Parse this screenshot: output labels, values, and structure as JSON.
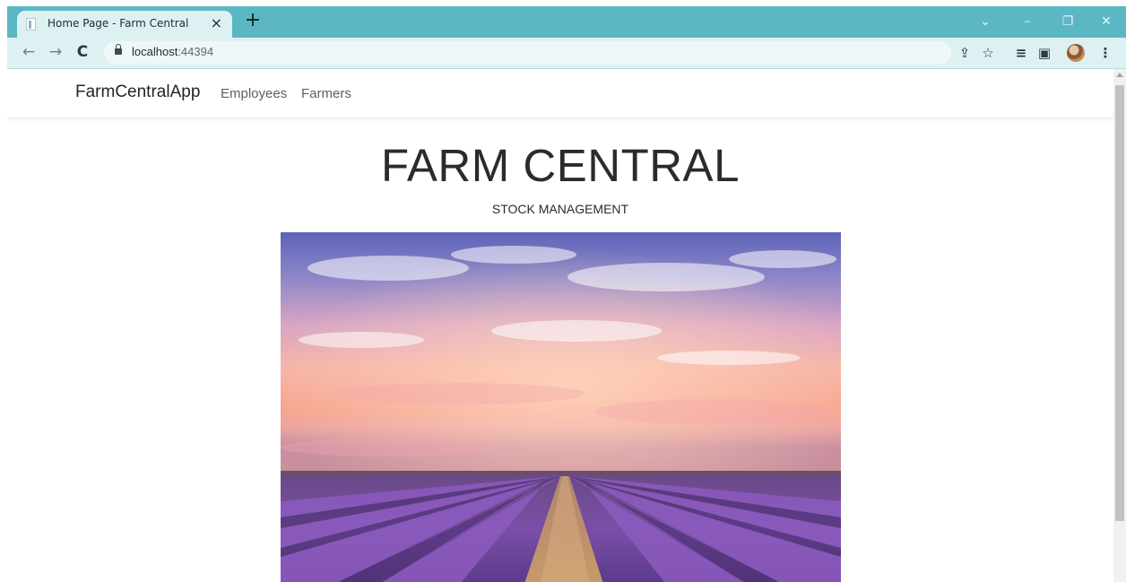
{
  "browser": {
    "tab_title": "Home Page - Farm Central",
    "tab_close": "×",
    "new_tab": "+",
    "url_host": "localhost",
    "url_port": ":44394",
    "icons": {
      "back": "←",
      "forward": "→",
      "reload": "C",
      "share": "⇪",
      "bookmark": "☆",
      "reading_list": "≡",
      "side_panel": "▣",
      "menu": "⋮",
      "tab_search": "⌄",
      "minimize": "–",
      "restore": "❐",
      "close": "✕"
    },
    "accent_color": "#5bb7c3",
    "toolbar_color": "#ddf1f3"
  },
  "site": {
    "brand": "FarmCentralApp",
    "nav": [
      "Employees",
      "Farmers"
    ],
    "title": "FARM CENTRAL",
    "subtitle": "STOCK MANAGEMENT"
  }
}
